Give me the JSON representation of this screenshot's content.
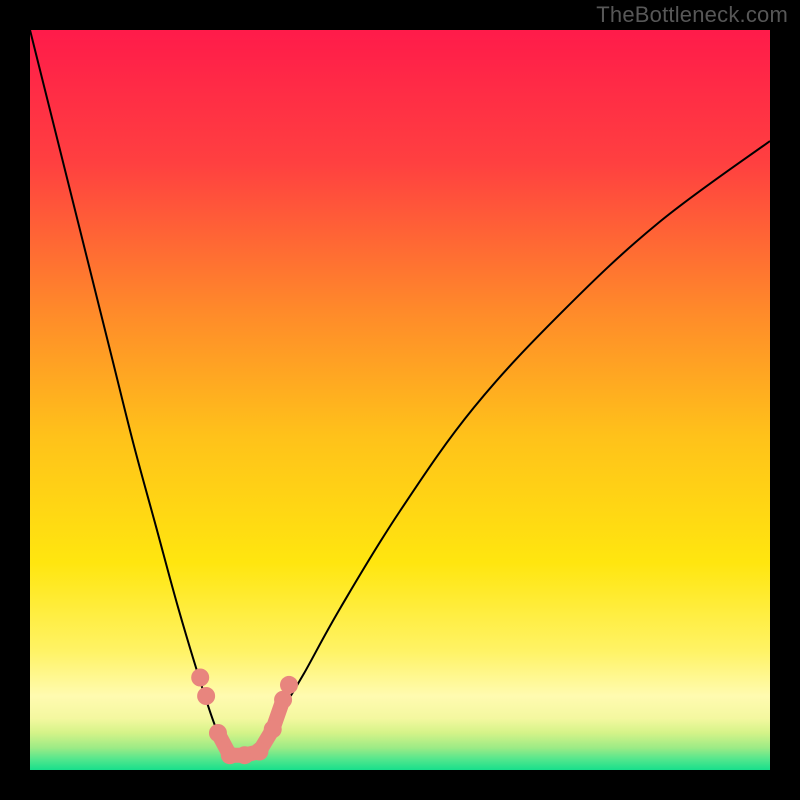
{
  "watermark": "TheBottleneck.com",
  "colors": {
    "black": "#000000",
    "curve": "#000000",
    "dot": "#e8857e",
    "gradient_top": "#ff1b4a",
    "gradient_mid1": "#ff7a2f",
    "gradient_mid2": "#ffd400",
    "gradient_low": "#fff99a",
    "gradient_base1": "#c9f57a",
    "gradient_base2": "#2fe58b"
  },
  "chart_data": {
    "type": "line",
    "title": "",
    "xlabel": "",
    "ylabel": "",
    "xlim": [
      0,
      100
    ],
    "ylim": [
      0,
      100
    ],
    "grid": false,
    "annotations": [
      "TheBottleneck.com"
    ],
    "series": [
      {
        "name": "bottleneck-curve",
        "x": [
          0,
          2,
          5,
          8,
          11,
          14,
          17,
          20,
          23,
          25,
          26.5,
          27.5,
          28.5,
          30,
          32,
          34,
          37,
          42,
          50,
          60,
          72,
          85,
          100
        ],
        "values": [
          100,
          92,
          80,
          68,
          56,
          44,
          33,
          22,
          12,
          6,
          3,
          2,
          2,
          3,
          5,
          8,
          13,
          22,
          35,
          49,
          62,
          74,
          85
        ]
      }
    ],
    "markers": [
      {
        "name": "dot-left-upper",
        "x": 23.0,
        "y": 12.5
      },
      {
        "name": "dot-left-mid",
        "x": 23.8,
        "y": 10.0
      },
      {
        "name": "dot-left-lower",
        "x": 25.4,
        "y": 5.0
      },
      {
        "name": "dot-floor-1",
        "x": 27.0,
        "y": 2.0
      },
      {
        "name": "dot-floor-2",
        "x": 29.0,
        "y": 2.0
      },
      {
        "name": "dot-floor-3",
        "x": 31.0,
        "y": 2.5
      },
      {
        "name": "dot-right-lower",
        "x": 32.8,
        "y": 5.5
      },
      {
        "name": "dot-right-mid",
        "x": 34.2,
        "y": 9.5
      },
      {
        "name": "dot-right-upper",
        "x": 35.0,
        "y": 11.5
      }
    ]
  }
}
